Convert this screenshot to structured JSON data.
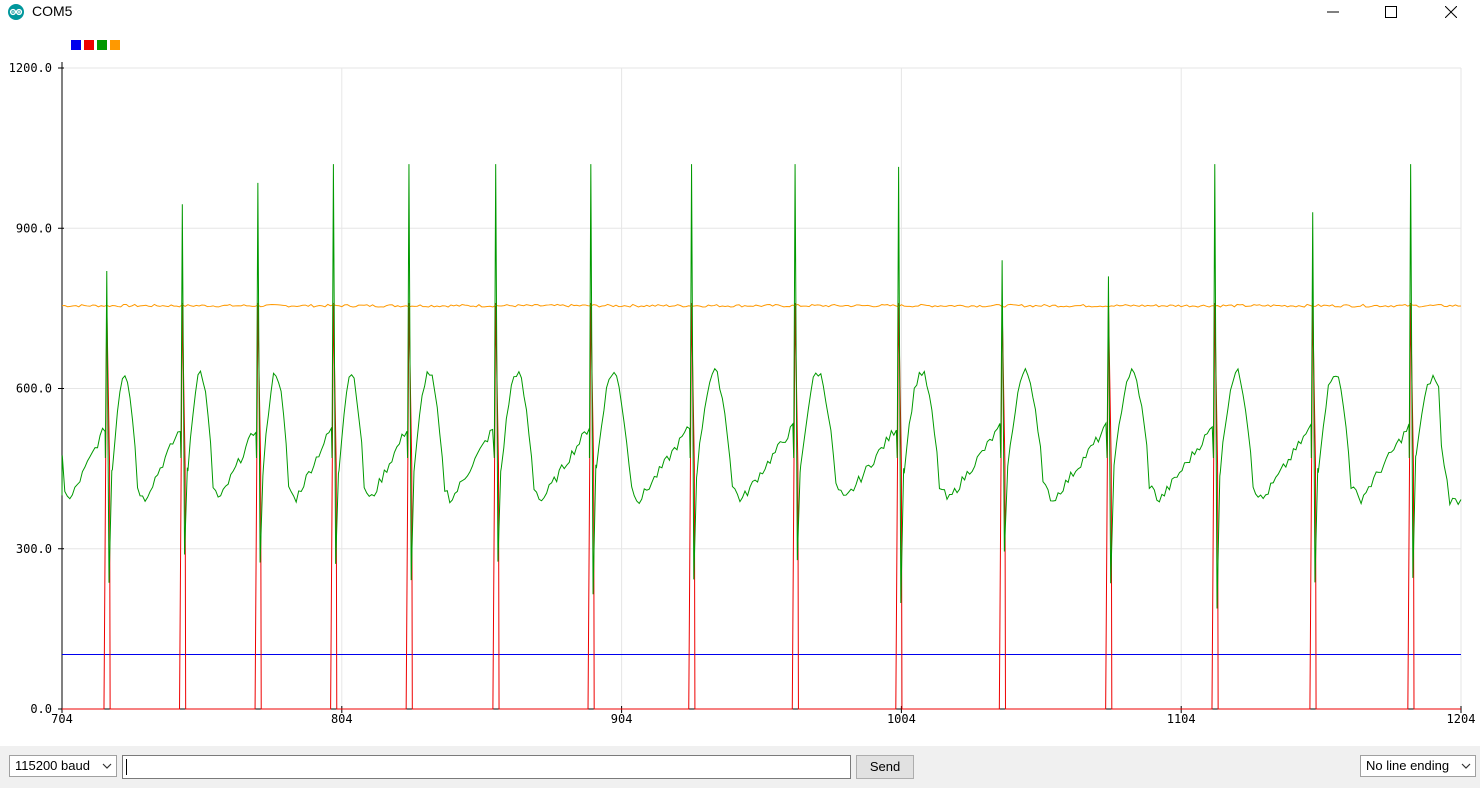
{
  "window": {
    "title": "COM5",
    "icon": "arduino-logo-icon",
    "buttons": [
      "minimize-icon",
      "maximize-icon",
      "close-icon"
    ]
  },
  "legend": {
    "colors": [
      "#0000ee",
      "#ee0000",
      "#009900",
      "#ff9900"
    ]
  },
  "chart_data": {
    "type": "line",
    "title": "",
    "xlabel": "",
    "ylabel": "",
    "xlim": [
      704,
      1204
    ],
    "ylim": [
      0,
      1200
    ],
    "x_ticks": [
      "704",
      "804",
      "904",
      "1004",
      "1104",
      "1204"
    ],
    "y_ticks": [
      "0.0",
      "300.0",
      "600.0",
      "900.0",
      "1200.0"
    ],
    "grid": true,
    "legend_position": "top-left",
    "beat_x": [
      720,
      747,
      774,
      801,
      828,
      859,
      893,
      929,
      966,
      1003,
      1040,
      1078,
      1116,
      1151,
      1186
    ],
    "beat_peaks": [
      820,
      945,
      985,
      1020,
      1020,
      1020,
      1020,
      1020,
      1020,
      1015,
      840,
      810,
      1020,
      930,
      1020
    ],
    "series": [
      {
        "color": "#0000ee",
        "style": "constant",
        "value": 102
      },
      {
        "color": "#ee0000",
        "style": "pulse",
        "base": 0,
        "peak": 760
      },
      {
        "color": "#009900",
        "style": "ecg",
        "baseline_range": [
          370,
          640
        ],
        "troughs_range": [
          170,
          300
        ]
      },
      {
        "color": "#ff9900",
        "style": "constant",
        "value": 755
      }
    ]
  },
  "controls": {
    "baud": "115200 baud",
    "message": "",
    "send_label": "Send",
    "line_ending": "No line ending"
  }
}
